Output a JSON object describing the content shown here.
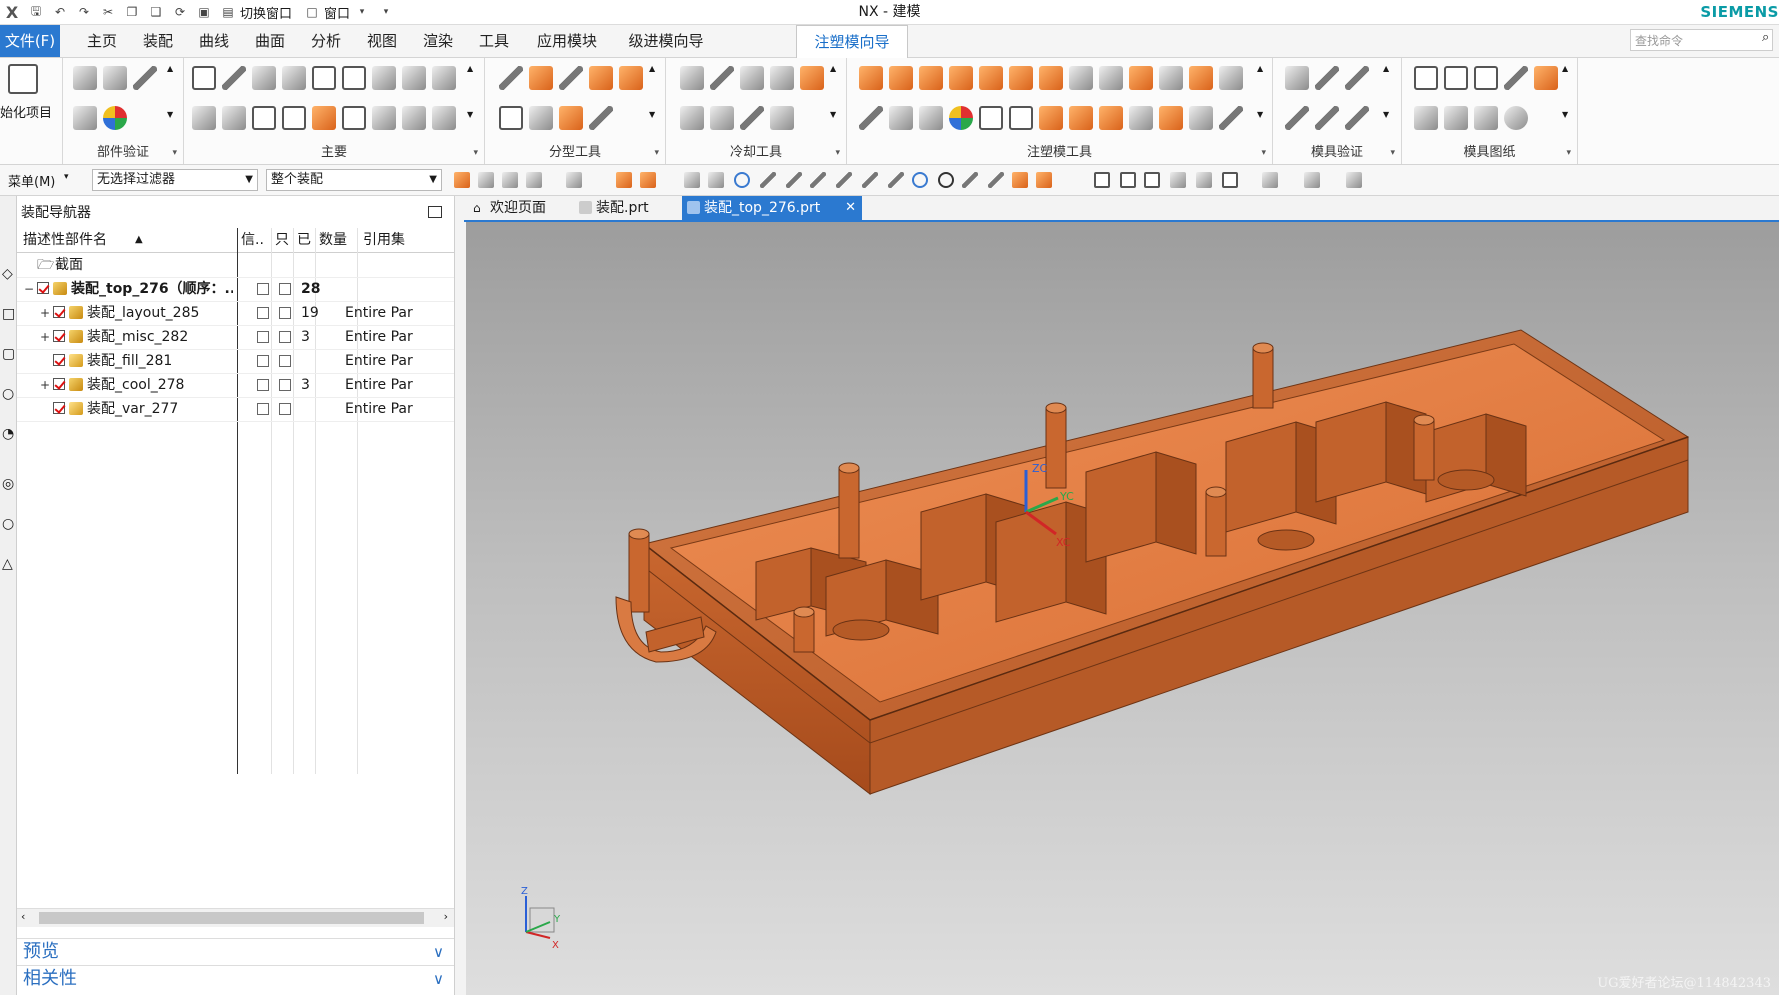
{
  "titlebar": {
    "app_title": "NX - 建模",
    "brand": "SIEMENS",
    "switch_window_label": "切换窗口",
    "window_menu_label": "窗口"
  },
  "ribbon_tabs": [
    "文件(F)",
    "主页",
    "装配",
    "曲线",
    "曲面",
    "分析",
    "视图",
    "渲染",
    "工具",
    "应用模块",
    "级进模向导",
    "注塑模向导"
  ],
  "active_tab": "注塑模向导",
  "command_search": {
    "placeholder": "查找命令"
  },
  "ribbon_groups": [
    {
      "label": "",
      "sub": "始化项目"
    },
    {
      "label": "部件验证"
    },
    {
      "label": "主要"
    },
    {
      "label": "分型工具"
    },
    {
      "label": "冷却工具"
    },
    {
      "label": "注塑模工具"
    },
    {
      "label": "模具验证"
    },
    {
      "label": "模具图纸"
    }
  ],
  "toolbar": {
    "menu_label": "菜单(M)",
    "filter_value": "无选择过滤器",
    "scope_value": "整个装配"
  },
  "navigator": {
    "title": "装配导航器",
    "columns": [
      "描述性部件名",
      "信..",
      "只",
      "已",
      "数量",
      "引用集"
    ],
    "rows": [
      {
        "name": "截面",
        "qty": "",
        "ref": "",
        "type": "folder",
        "toggle": ""
      },
      {
        "name": "装配_top_276（顺序：...",
        "qty": "28",
        "ref": "",
        "type": "top",
        "toggle": "−"
      },
      {
        "name": "装配_layout_285",
        "qty": "19",
        "ref": "Entire Par",
        "type": "asm",
        "toggle": "+"
      },
      {
        "name": "装配_misc_282",
        "qty": "3",
        "ref": "Entire Par",
        "type": "asm",
        "toggle": "+"
      },
      {
        "name": "装配_fill_281",
        "qty": "",
        "ref": "Entire Par",
        "type": "part",
        "toggle": ""
      },
      {
        "name": "装配_cool_278",
        "qty": "3",
        "ref": "Entire Par",
        "type": "asm",
        "toggle": "+"
      },
      {
        "name": "装配_var_277",
        "qty": "",
        "ref": "Entire Par",
        "type": "part",
        "toggle": ""
      }
    ],
    "preview_label": "预览",
    "relations_label": "相关性"
  },
  "doc_tabs": [
    "欢迎页面",
    "装配.prt",
    "装配_top_276.prt"
  ],
  "active_doc_tab": "装配_top_276.prt",
  "viewport": {
    "triad_labels": {
      "x": "X",
      "y": "Y",
      "z": "Z",
      "xc": "XC",
      "yc": "YC",
      "zc": "ZC"
    },
    "watermark": "UG爱好者论坛@114842343",
    "model_color": "#c4642e"
  },
  "colors": {
    "accent": "#2b79d0",
    "brand": "#0a9ba6",
    "active_tab_text": "#1a6fc9"
  }
}
